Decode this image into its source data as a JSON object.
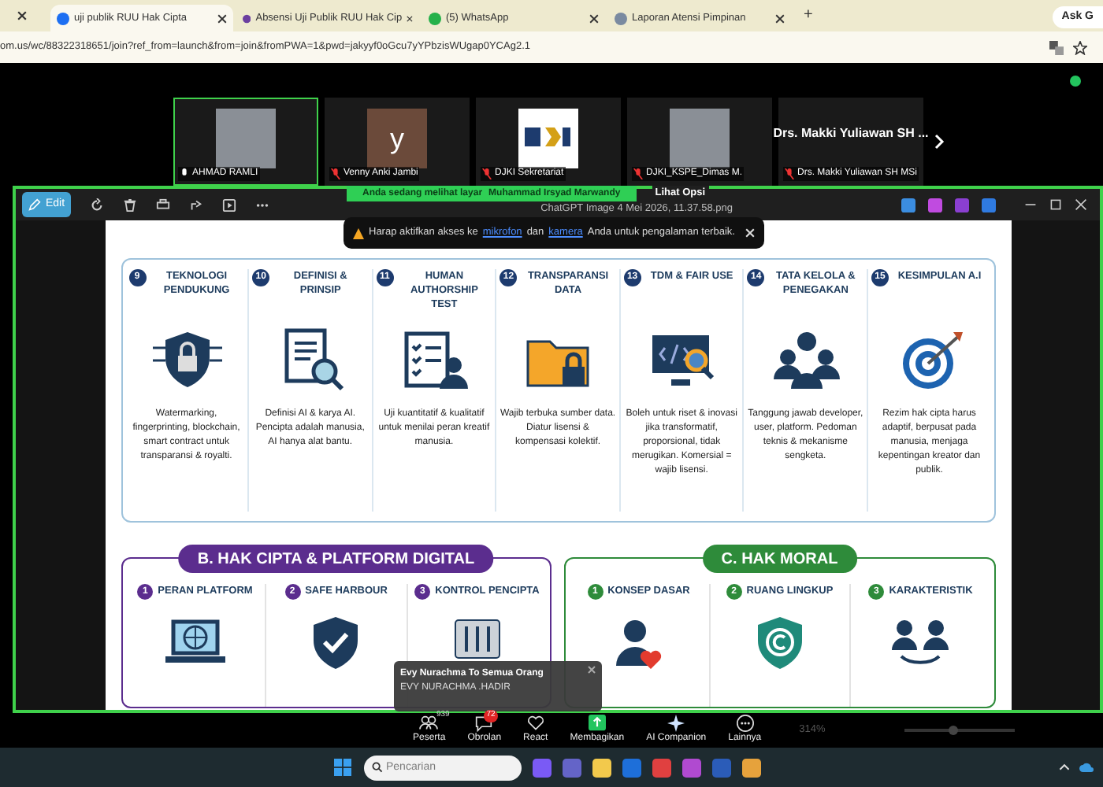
{
  "browser": {
    "tabs": [
      {
        "label": "uji publik RUU Hak Cipta",
        "selected": true
      },
      {
        "label": "Absensi Uji Publik RUU Hak Cip",
        "selected": false
      },
      {
        "label": "(5) WhatsApp",
        "selected": false
      },
      {
        "label": "Laporan Atensi Pimpinan",
        "selected": false
      }
    ],
    "new_tab": "+",
    "ask_button": "Ask G",
    "url": "om.us/wc/88322318651/join?ref_from=launch&from=join&fromPWA=1&pwd=jakyyf0oGcu7yYPbzisWUgap0YCAg2.1"
  },
  "participants": [
    {
      "name": "AHMAD RAMLI",
      "kind": "photo",
      "muted": false,
      "speaking": true
    },
    {
      "name": "Venny Anki Jambi",
      "kind": "letter",
      "initial": "y",
      "muted": true,
      "speaking": false
    },
    {
      "name": "DJKI Sekretariat",
      "kind": "logo",
      "muted": true,
      "speaking": false
    },
    {
      "name": "DJKI_KSPE_Dimas M.",
      "kind": "photo",
      "muted": true,
      "speaking": false
    },
    {
      "name": "Drs. Makki Yuliawan SH MSi",
      "kind": "text",
      "heading": "Drs. Makki Yuliawan SH ...",
      "muted": true,
      "speaking": false
    }
  ],
  "share_banner": {
    "text": "Anda sedang melihat layar",
    "presenter": "Muhammad Irsyad Marwandy",
    "options": "Lihat Opsi"
  },
  "viewer": {
    "edit": "Edit",
    "file_name": "ChatGPT Image 4 Mei 2026, 11.37.58.png",
    "zoom": "314%",
    "zoom_slider": {
      "level": 0.45
    }
  },
  "notice": {
    "before": "Harap aktifkan akses ke",
    "link_1": "mikrofon",
    "middle": "dan",
    "link_2": "kamera",
    "after": "Anda untuk pengalaman terbaik."
  },
  "infographic": {
    "steps": [
      {
        "number": "9",
        "title": "TEKNOLOGI PENDUKUNG",
        "text": "Watermarking, fingerprinting, blockchain, smart contract untuk transparansi & royalti."
      },
      {
        "number": "10",
        "title": "DEFINISI & PRINSIP",
        "text": "Definisi AI & karya AI. Pencipta adalah manusia, AI hanya alat bantu."
      },
      {
        "number": "11",
        "title": "HUMAN AUTHORSHIP TEST",
        "text": "Uji kuantitatif & kualitatif untuk menilai peran kreatif manusia."
      },
      {
        "number": "12",
        "title": "TRANSPARANSI DATA",
        "text": "Wajib terbuka sumber data. Diatur lisensi & kompensasi kolektif."
      },
      {
        "number": "13",
        "title": "TDM & FAIR USE",
        "text": "Boleh untuk riset & inovasi jika transformatif, proporsional, tidak merugikan. Komersial = wajib lisensi."
      },
      {
        "number": "14",
        "title": "TATA KELOLA & PENEGAKAN",
        "text": "Tanggung jawab developer, user, platform. Pedoman teknis & mekanisme sengketa."
      },
      {
        "number": "15",
        "title": "KESIMPULAN A.I",
        "text": "Rezim hak cipta harus adaptif, berpusat pada manusia, menjaga kepentingan kreator dan publik."
      }
    ],
    "sections": [
      {
        "title": "B. HAK CIPTA & PLATFORM DIGITAL",
        "color": "#5b2d8e",
        "items": [
          {
            "number": "1",
            "title": "PERAN PLATFORM"
          },
          {
            "number": "2",
            "title": "SAFE HARBOUR"
          },
          {
            "number": "3",
            "title": "KONTROL PENCIPTA"
          }
        ]
      },
      {
        "title": "C. HAK MORAL",
        "color": "#2e8b3a",
        "items": [
          {
            "number": "1",
            "title": "KONSEP DASAR"
          },
          {
            "number": "2",
            "title": "RUANG LINGKUP"
          },
          {
            "number": "3",
            "title": "KARAKTERISTIK"
          }
        ]
      }
    ]
  },
  "chat_toast": {
    "sender": "Evy Nurachma To Semua Orang",
    "message": "EVY NURACHMA .HADIR"
  },
  "meeting_controls": [
    {
      "kind": "people",
      "label": "Peserta",
      "count": "939"
    },
    {
      "kind": "chat",
      "label": "Obrolan",
      "badge": "72"
    },
    {
      "kind": "react",
      "label": "React"
    },
    {
      "kind": "share",
      "label": "Membagikan"
    },
    {
      "kind": "ai",
      "label": "AI Companion"
    },
    {
      "kind": "more",
      "label": "Lainnya"
    }
  ],
  "taskbar": {
    "search_placeholder": "Pencarian"
  }
}
